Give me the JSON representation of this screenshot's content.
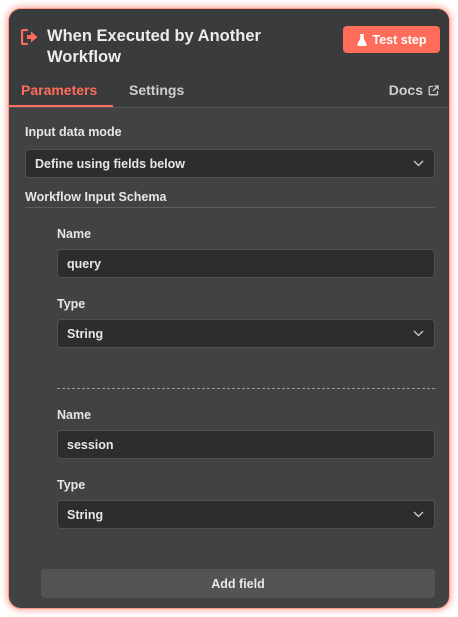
{
  "node": {
    "title": "When Executed by Another Workflow",
    "test_step_label": "Test step",
    "accent_color": "#ff6d5a",
    "title_icon": "sign-in-icon",
    "test_icon": "flask-icon"
  },
  "tabs": [
    {
      "label": "Parameters",
      "active": true
    },
    {
      "label": "Settings",
      "active": false
    }
  ],
  "docs": {
    "label": "Docs",
    "icon": "external-link-icon"
  },
  "input_mode": {
    "label": "Input data mode",
    "value": "Define using fields below"
  },
  "schema": {
    "label": "Workflow Input Schema",
    "fields": [
      {
        "name_label": "Name",
        "name_value": "query",
        "type_label": "Type",
        "type_value": "String"
      },
      {
        "name_label": "Name",
        "name_value": "session",
        "type_label": "Type",
        "type_value": "String"
      }
    ]
  },
  "add_field_label": "Add field"
}
